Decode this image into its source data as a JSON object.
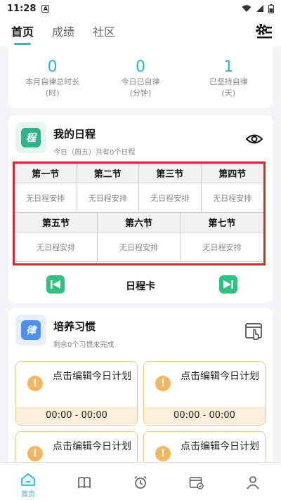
{
  "status": {
    "time": "11:28",
    "badge": "A"
  },
  "topnav": {
    "tabs": [
      "首页",
      "成绩",
      "社区"
    ]
  },
  "stats": [
    {
      "value": "0",
      "label": "本月自律总时长",
      "unit": "(时)"
    },
    {
      "value": "0",
      "label": "今日已自律",
      "unit": "(分钟)"
    },
    {
      "value": "1",
      "label": "已坚持自律",
      "unit": "(天)"
    }
  ],
  "schedule": {
    "icon_char": "程",
    "title": "我的日程",
    "subtitle": "今日（周五）共有0个日程",
    "row1_headers": [
      "第一节",
      "第二节",
      "第三节",
      "第四节"
    ],
    "row2_headers": [
      "第五节",
      "第六节",
      "第七节"
    ],
    "empty_text": "无日程安排",
    "nav_label": "日程卡"
  },
  "habits": {
    "icon_char": "律",
    "title": "培养习惯",
    "subtitle": "剩余0个习惯未完成",
    "items": [
      {
        "text": "点击编辑今日计划",
        "time": "00:00 - 00:00"
      },
      {
        "text": "点击编辑今日计划",
        "time": "00:00 - 00:00"
      },
      {
        "text": "点击编辑今日计划",
        "time": ""
      },
      {
        "text": "点击编辑今日计划",
        "time": ""
      }
    ]
  },
  "bottombar": {
    "home_label": "首页"
  },
  "colors": {
    "accent": "#2bb7c6",
    "green": "#2ec27e",
    "schedule_icon": "#2fb38a",
    "habit_icon": "#4f8ff0",
    "highlight": "#d32b2b",
    "warning": "#f1b760"
  }
}
